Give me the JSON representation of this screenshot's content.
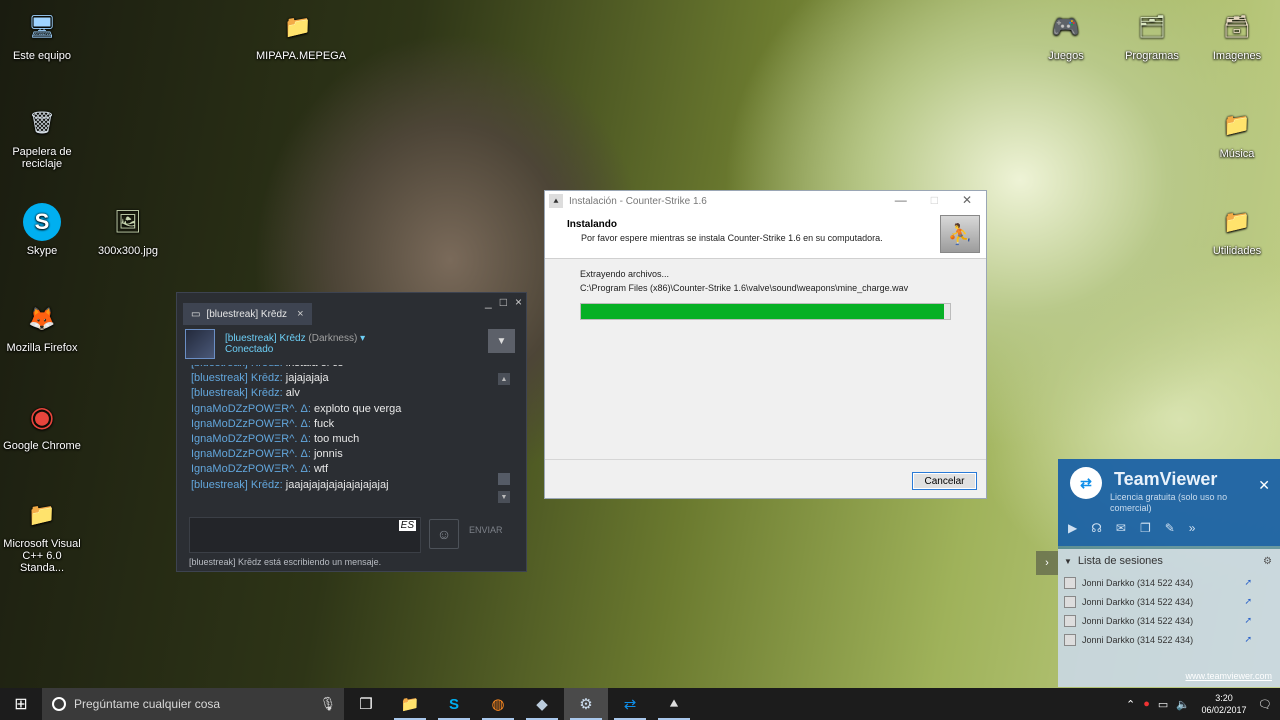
{
  "desktop_icons": [
    {
      "label": "Este equipo",
      "icon": "computer-icon",
      "glyph": "🖥"
    },
    {
      "label": "MIPAPA.MEPEGA",
      "icon": "folder-icon",
      "glyph": "📁"
    },
    {
      "label": "Papelera de reciclaje",
      "icon": "recycle-bin-icon",
      "glyph": "🗑"
    },
    {
      "label": "Skype",
      "icon": "skype-icon",
      "glyph": "S"
    },
    {
      "label": "300x300.jpg",
      "icon": "image-file-icon",
      "glyph": "🖼"
    },
    {
      "label": "Mozilla Firefox",
      "icon": "firefox-icon",
      "glyph": "🦊"
    },
    {
      "label": "Google Chrome",
      "icon": "chrome-icon",
      "glyph": "◉"
    },
    {
      "label": "Microsoft Visual C++ 6.0 Standa...",
      "icon": "folder-icon",
      "glyph": "📁"
    },
    {
      "label": "Juegos",
      "icon": "games-shortcut-icon",
      "glyph": "🎮"
    },
    {
      "label": "Programas",
      "icon": "programs-shortcut-icon",
      "glyph": "🗂"
    },
    {
      "label": "Imagenes",
      "icon": "images-shortcut-icon",
      "glyph": "🗃"
    },
    {
      "label": "Música",
      "icon": "folder-icon",
      "glyph": "📁"
    },
    {
      "label": "Utilidades",
      "icon": "folder-icon",
      "glyph": "📁"
    }
  ],
  "steam_chat": {
    "tab_label": "[bluestreak] Krēdz",
    "tab_close": "×",
    "controls": {
      "minimize": "_",
      "maximize": "□",
      "close": "×"
    },
    "friend_name": "[bluestreak] Krēdz",
    "friend_game": "(Darkness)",
    "friend_status": "Conectado",
    "messages": [
      {
        "who": "[bluestreak] Krēdz:",
        "text": "instala el cs"
      },
      {
        "who": "[bluestreak] Krēdz:",
        "text": "jajajajaja"
      },
      {
        "who": "[bluestreak] Krēdz:",
        "text": "alv"
      },
      {
        "who": "IgnaMoDZzPOWΞR^. Δ:",
        "text": "exploto que verga"
      },
      {
        "who": "IgnaMoDZzPOWΞR^. Δ:",
        "text": "fuck"
      },
      {
        "who": "IgnaMoDZzPOWΞR^. Δ:",
        "text": "too much"
      },
      {
        "who": "IgnaMoDZzPOWΞR^. Δ:",
        "text": "jonnis"
      },
      {
        "who": "IgnaMoDZzPOWΞR^. Δ:",
        "text": "wtf"
      },
      {
        "who": "[bluestreak] Krēdz:",
        "text": "jaajajajajajajajajajajaj"
      }
    ],
    "input_lang": "ES",
    "send_label": "ENVIAR",
    "typing_notice": "[bluestreak] Krēdz está escribiendo un mensaje."
  },
  "installer": {
    "title": "Instalación - Counter-Strike 1.6",
    "heading": "Instalando",
    "subheading": "Por favor espere mientras se instala Counter-Strike 1.6 en su computadora.",
    "status": "Extrayendo archivos...",
    "current_file": "C:\\Program Files (x86)\\Counter-Strike 1.6\\valve\\sound\\weapons\\mine_charge.wav",
    "progress": 0.985,
    "cancel_label": "Cancelar",
    "progress_color": "#06b025"
  },
  "teamviewer": {
    "name": "TeamViewer",
    "license": "Licencia gratuita (solo uso no comercial)",
    "sessions_title": "Lista de sesiones",
    "sessions": [
      "Jonni Darkko (314 522 434)",
      "Jonni Darkko (314 522 434)",
      "Jonni Darkko (314 522 434)",
      "Jonni Darkko (314 522 434)"
    ],
    "url": "www.teamviewer.com"
  },
  "taskbar": {
    "search_placeholder": "Pregúntame cualquier cosa",
    "time": "3:20",
    "date": "06/02/2017"
  }
}
